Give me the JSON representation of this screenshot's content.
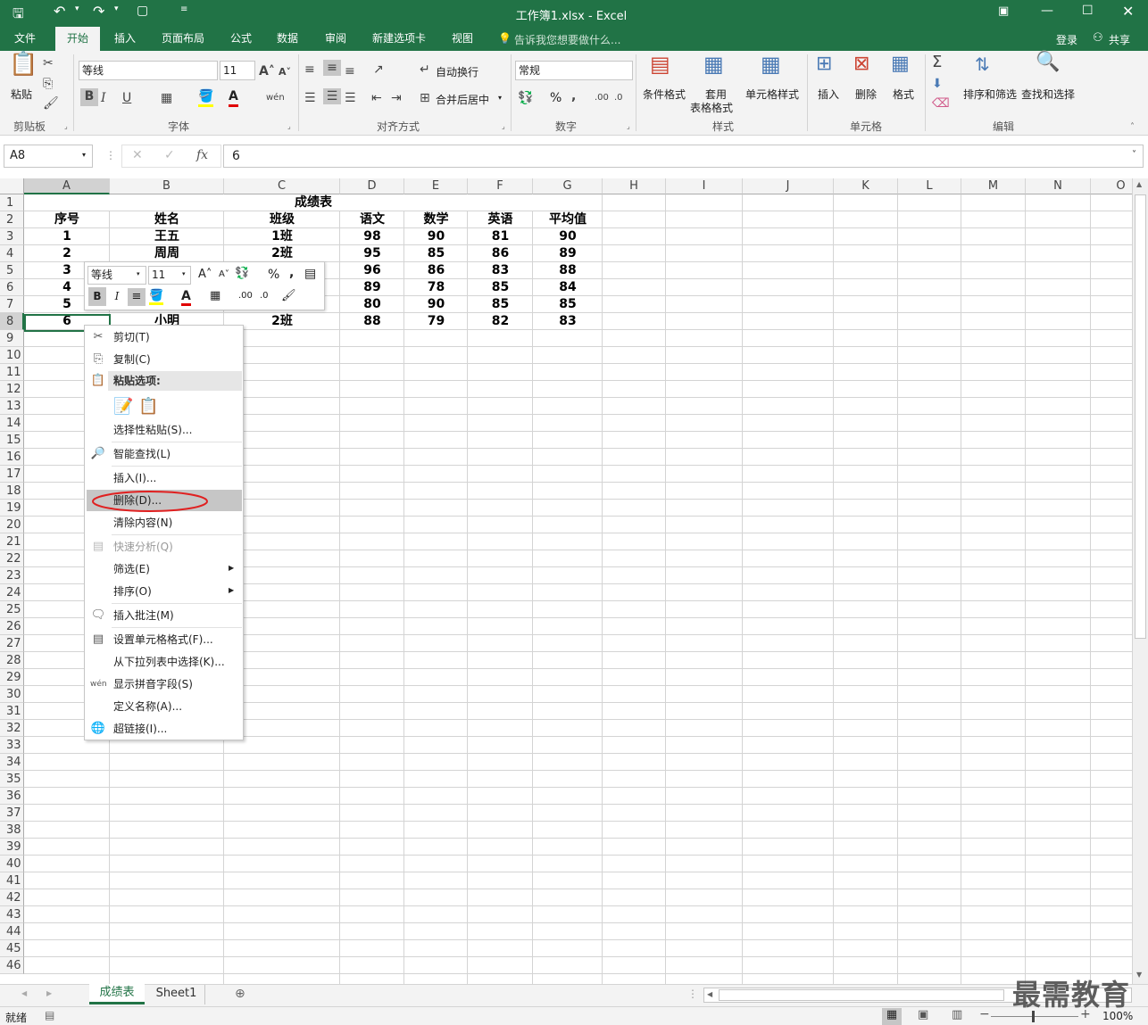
{
  "window": {
    "title": "工作簿1.xlsx - Excel"
  },
  "menu": {
    "tabs": [
      "文件",
      "开始",
      "插入",
      "页面布局",
      "公式",
      "数据",
      "审阅",
      "新建选项卡",
      "视图"
    ],
    "active": "开始",
    "search": "告诉我您想要做什么...",
    "login": "登录",
    "share": "共享"
  },
  "ribbon": {
    "paste": "粘贴",
    "font_name": "等线",
    "font_size": "11",
    "bold": "B",
    "italic": "I",
    "underline": "U",
    "wrap": "自动换行",
    "merge": "合并后居中",
    "number_format": "常规",
    "percent": "%",
    "cond_format": "条件格式",
    "table_format_1": "套用",
    "table_format_2": "表格格式",
    "cell_style": "单元格样式",
    "insert": "插入",
    "delete": "删除",
    "format": "格式",
    "sort_filter": "排序和筛选",
    "find_select": "查找和选择",
    "groups": {
      "clipboard": "剪贴板",
      "font": "字体",
      "align": "对齐方式",
      "number": "数字",
      "styles": "样式",
      "cells": "单元格",
      "edit": "编辑"
    }
  },
  "formula_bar": {
    "name_box": "A8",
    "fx": "fx",
    "value": "6"
  },
  "columns": [
    "A",
    "B",
    "C",
    "D",
    "E",
    "F",
    "G",
    "H",
    "I",
    "J",
    "K",
    "L",
    "M",
    "N",
    "O"
  ],
  "sheet": {
    "title": "成绩表",
    "headers": [
      "序号",
      "姓名",
      "班级",
      "语文",
      "数学",
      "英语",
      "平均值"
    ],
    "rows": [
      [
        "1",
        "王五",
        "1班",
        "98",
        "90",
        "81",
        "90"
      ],
      [
        "2",
        "周周",
        "2班",
        "95",
        "85",
        "86",
        "89"
      ],
      [
        "3",
        "",
        "",
        "96",
        "86",
        "83",
        "88"
      ],
      [
        "4",
        "",
        "",
        "89",
        "78",
        "85",
        "84"
      ],
      [
        "5",
        "",
        "",
        "80",
        "90",
        "85",
        "85"
      ],
      [
        "6",
        "小明",
        "2班",
        "88",
        "79",
        "82",
        "83"
      ]
    ]
  },
  "mini_toolbar": {
    "font": "等线",
    "size": "11",
    "bold": "B",
    "italic": "I",
    "percent": "%"
  },
  "context_menu": {
    "cut": "剪切(T)",
    "copy": "复制(C)",
    "paste_options": "粘贴选项:",
    "paste_special": "选择性粘贴(S)...",
    "smart_lookup": "智能查找(L)",
    "insert": "插入(I)...",
    "delete": "删除(D)...",
    "clear": "清除内容(N)",
    "quick_analysis": "快速分析(Q)",
    "filter": "筛选(E)",
    "sort": "排序(O)",
    "insert_comment": "插入批注(M)",
    "format_cells": "设置单元格格式(F)...",
    "pick_list": "从下拉列表中选择(K)...",
    "phonetic": "显示拼音字段(S)",
    "define_name": "定义名称(A)...",
    "hyperlink": "超链接(I)..."
  },
  "sheet_tabs": [
    "成绩表",
    "Sheet1"
  ],
  "status": {
    "ready": "就绪",
    "zoom": "100%"
  },
  "watermark": "最需教育"
}
